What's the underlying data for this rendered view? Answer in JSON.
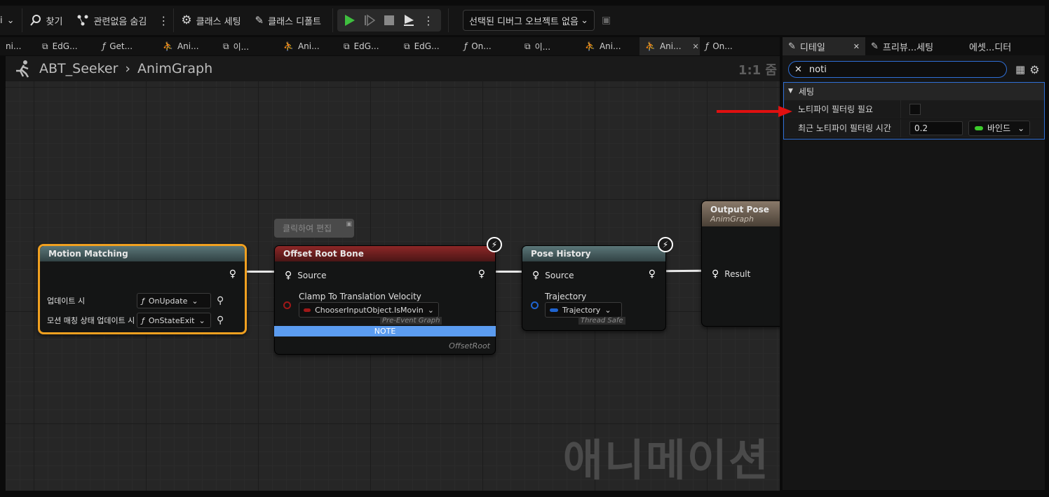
{
  "toolbar": {
    "cut_label": "i",
    "find_label": "찾기",
    "hide_unrelated_label": "관련없음 숨김",
    "class_settings_label": "클래스 세팅",
    "class_defaults_label": "클래스 디폴트",
    "debug_select_value": "선택된 디버그 오브젝트 없음"
  },
  "tabs": [
    {
      "label": "ni...",
      "icon": "anim-icon"
    },
    {
      "label": "EdG...",
      "icon": "graph-icon"
    },
    {
      "label": "Get...",
      "icon": "function-icon"
    },
    {
      "label": "Ani...",
      "icon": "anim-icon"
    },
    {
      "label": "이...",
      "icon": "graph-icon"
    },
    {
      "label": "Ani...",
      "icon": "anim-icon"
    },
    {
      "label": "EdG...",
      "icon": "graph-icon"
    },
    {
      "label": "EdG...",
      "icon": "graph-icon"
    },
    {
      "label": "On...",
      "icon": "function-icon"
    },
    {
      "label": "이...",
      "icon": "graph-icon"
    },
    {
      "label": "Ani...",
      "icon": "anim-icon"
    },
    {
      "label": "Ani...",
      "icon": "anim-icon",
      "active": true
    },
    {
      "label": "On...",
      "icon": "function-icon"
    }
  ],
  "graph": {
    "breadcrumb_root": "ABT_Seeker",
    "breadcrumb_leaf": "AnimGraph",
    "zoom": "1:1 줌",
    "watermark": "애니메이션",
    "tooltip": "클릭하여 편집"
  },
  "nodes": {
    "motion_matching": {
      "title": "Motion Matching",
      "row1_label": "업데이트 시",
      "row1_value": "OnUpdate",
      "row2_label": "모션 매칭 상태 업데이트 시",
      "row2_value": "OnStateExit"
    },
    "offset_root_bone": {
      "title": "Offset Root Bone",
      "source_label": "Source",
      "clamp_label": "Clamp To Translation Velocity",
      "clamp_value": "ChooserInputObject.IsMovin",
      "tag": "Pre-Event Graph",
      "note": "NOTE",
      "footer": "OffsetRoot"
    },
    "pose_history": {
      "title": "Pose History",
      "source_label": "Source",
      "trajectory_label": "Trajectory",
      "trajectory_value": "Trajectory",
      "tag": "Thread Safe"
    },
    "output_pose": {
      "title": "Output Pose",
      "subtitle": "AnimGraph",
      "result_label": "Result"
    }
  },
  "panel": {
    "tabs": [
      {
        "label": "디테일",
        "active": true
      },
      {
        "label": "프리뷰...세팅"
      },
      {
        "label": "에셋...디터"
      }
    ],
    "search_value": "noti",
    "section_label": "세팅",
    "props": [
      {
        "label": "노티파이 필터링 필요",
        "checked": false
      },
      {
        "label": "최근 노티파이 필터링 시간",
        "value": "0.2",
        "bind_label": "바인드"
      }
    ]
  },
  "colors": {
    "accent_blue": "#2f6fd6",
    "selection_orange": "#f0a020",
    "play_green": "#3fbf3f",
    "arrow_red": "#e01010",
    "bind_green": "#3ccc2c"
  }
}
